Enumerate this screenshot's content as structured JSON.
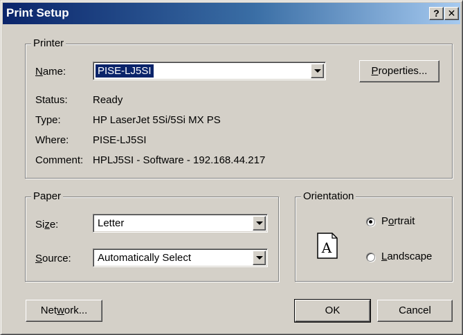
{
  "window": {
    "title": "Print Setup",
    "help_glyph": "?",
    "close_glyph": "✕"
  },
  "printer": {
    "legend": "Printer",
    "name_label_pre": "",
    "name_label_u": "N",
    "name_label_post": "ame:",
    "name_value": "PISE-LJ5SI",
    "properties_u": "P",
    "properties_post": "roperties...",
    "status_label": "Status:",
    "status_value": "Ready",
    "type_label": "Type:",
    "type_value": "HP LaserJet 5Si/5Si MX PS",
    "where_label": "Where:",
    "where_value": "PISE-LJ5SI",
    "comment_label": "Comment:",
    "comment_value": "HPLJ5SI - Software - 192.168.44.217"
  },
  "paper": {
    "legend": "Paper",
    "size_pre": "Si",
    "size_u": "z",
    "size_post": "e:",
    "size_value": "Letter",
    "source_u": "S",
    "source_post": "ource:",
    "source_value": "Automatically Select"
  },
  "orientation": {
    "legend": "Orientation",
    "portrait_pre": "P",
    "portrait_u": "o",
    "portrait_post": "rtrait",
    "landscape_pre": "",
    "landscape_u": "L",
    "landscape_post": "andscape",
    "selected": "portrait",
    "page_glyph": "A"
  },
  "buttons": {
    "network_pre": "Net",
    "network_u": "w",
    "network_post": "ork...",
    "ok": "OK",
    "cancel": "Cancel"
  }
}
